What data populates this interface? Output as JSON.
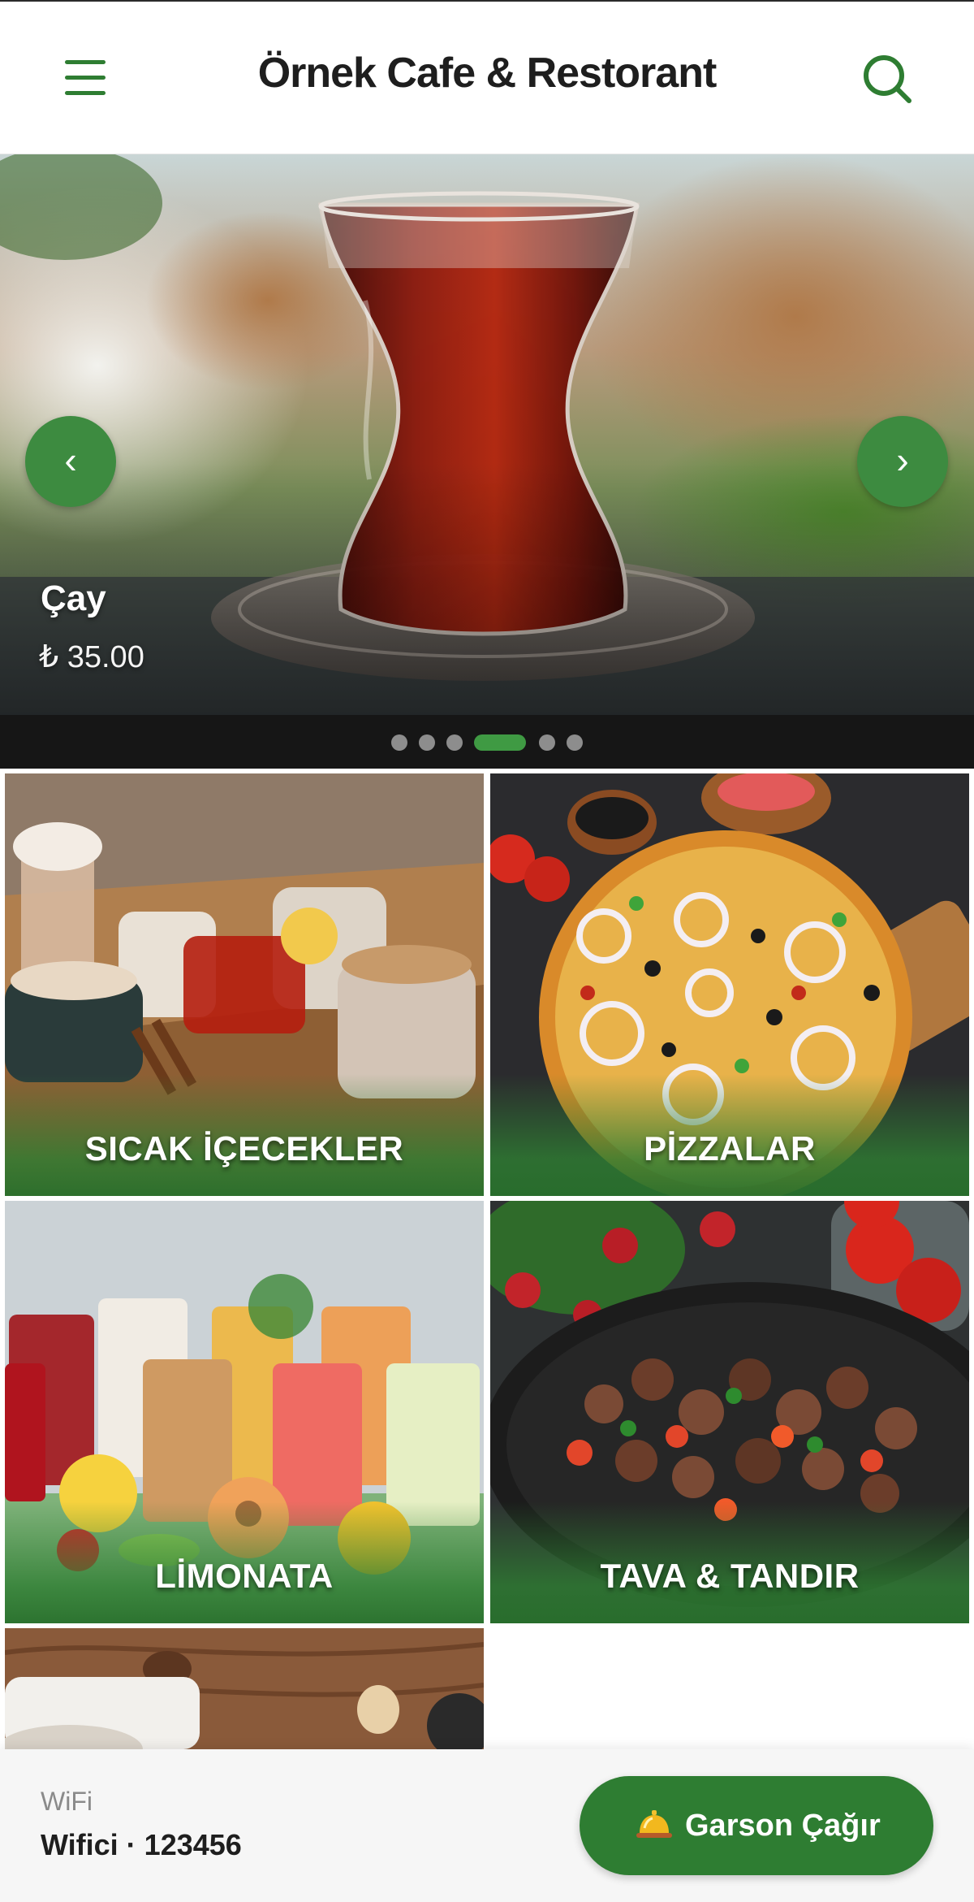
{
  "header": {
    "title": "Örnek Cafe & Restorant",
    "menu_icon": "hamburger-menu-icon",
    "search_icon": "search-icon",
    "accent_color": "#2e7d32"
  },
  "slider": {
    "item_name": "Çay",
    "item_price": "₺ 35.00",
    "prev_icon": "‹",
    "next_icon": "›",
    "total_slides": 6,
    "active_index": 3
  },
  "categories": [
    {
      "label": "SICAK İÇECEKLER"
    },
    {
      "label": "PİZZALAR"
    },
    {
      "label": "LİMONATA"
    },
    {
      "label": "TAVA & TANDIR"
    },
    {
      "label": ""
    }
  ],
  "footer": {
    "wifi_label": "WiFi",
    "wifi_value": "Wifici · 123456",
    "waiter_button": "Garson Çağır",
    "waiter_icon": "service-bell-icon"
  }
}
